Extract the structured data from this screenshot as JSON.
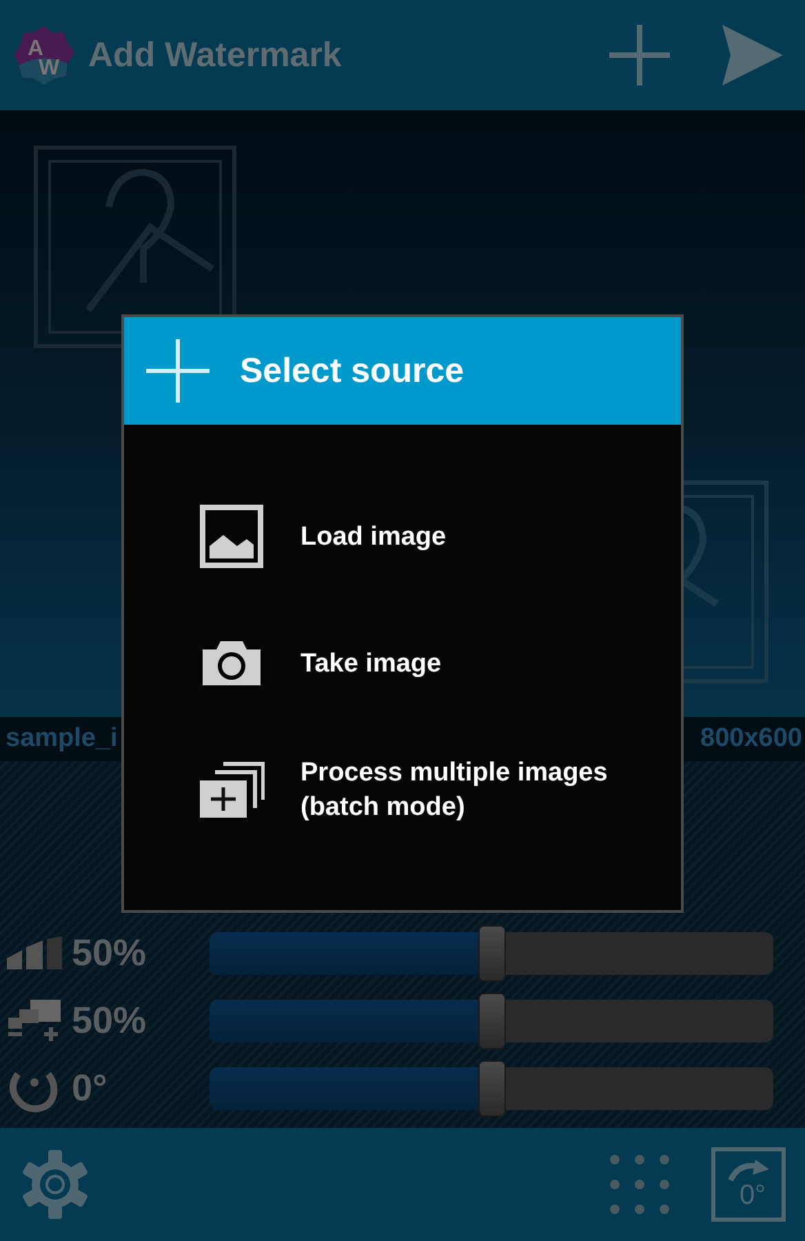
{
  "app_bar": {
    "logo_letters": [
      "A",
      "W"
    ],
    "title": "Add Watermark"
  },
  "file_bar": {
    "name": "sample_i",
    "size": "800x600"
  },
  "sliders": [
    {
      "kind": "opacity",
      "reading": "50%",
      "level": 0.5
    },
    {
      "kind": "scale",
      "reading": "50%",
      "level": 0.5
    },
    {
      "kind": "rotation",
      "reading": "0°",
      "level": 0.5
    }
  ],
  "bottom_bar": {
    "rotate_reading": "0°"
  },
  "dialog": {
    "title": "Select source",
    "items": [
      {
        "kind": "image",
        "label": "Load image"
      },
      {
        "kind": "camera",
        "label": "Take image"
      },
      {
        "kind": "batch",
        "label": "Process multiple images (batch mode)"
      }
    ]
  }
}
